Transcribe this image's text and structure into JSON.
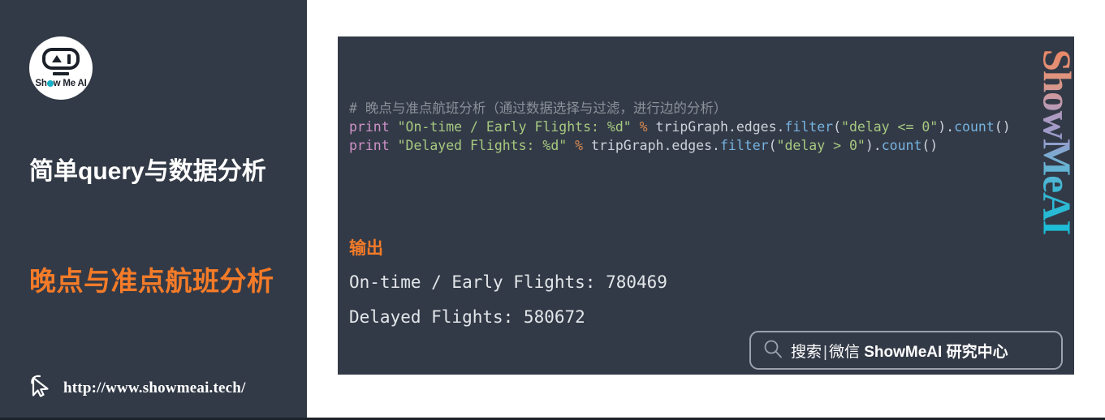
{
  "colors": {
    "panel_bg": "#333a47",
    "page_bg": "#ffffff",
    "accent_orange": "#f47b28",
    "text_white": "#ffffff",
    "code_comment": "#8a9199",
    "code_keyword": "#ce92c8",
    "code_string": "#a6c980",
    "code_operator": "#d6884f",
    "code_function": "#76b3e0",
    "code_plain": "#cdd3da"
  },
  "sidebar": {
    "logo": {
      "brand_text_before": "Sh",
      "brand_text_after": "w Me AI",
      "icon_name": "showmeai-robot-logo"
    },
    "heading": "简单query与数据分析",
    "subheading": "晚点与准点航班分析",
    "url": "http://www.showmeai.tech/",
    "cursor_icon": "cursor-arrow-icon"
  },
  "code_panel": {
    "code": {
      "line1": {
        "comment": "# 晚点与准点航班分析（通过数据选择与过滤，进行边的分析）"
      },
      "line2": {
        "keyword": "print",
        "string": "\"On-time / Early Flights: %d\"",
        "operator": "%",
        "object": " tripGraph.edges.",
        "fn1": "filter",
        "paren_open": "(",
        "arg": "\"delay <= 0\"",
        "paren_close": ").",
        "fn2": "count",
        "tail": "()"
      },
      "line3": {
        "keyword": "print",
        "string": "\"Delayed Flights: %d\"",
        "operator": "%",
        "object": " tripGraph.edges.",
        "fn1": "filter",
        "paren_open": "(",
        "arg": "\"delay > 0\"",
        "paren_close": ").",
        "fn2": "count",
        "tail": "()"
      }
    },
    "output_label": "输出",
    "output_lines": [
      "On-time / Early Flights: 780469",
      "Delayed Flights: 580672"
    ],
    "watermark_text": "ShowMeAI",
    "search_bar": {
      "icon": "search-icon",
      "prefix": "搜索",
      "separator": "|",
      "channel": "微信",
      "brand": "ShowMeAI",
      "suffix": "研究中心"
    }
  }
}
